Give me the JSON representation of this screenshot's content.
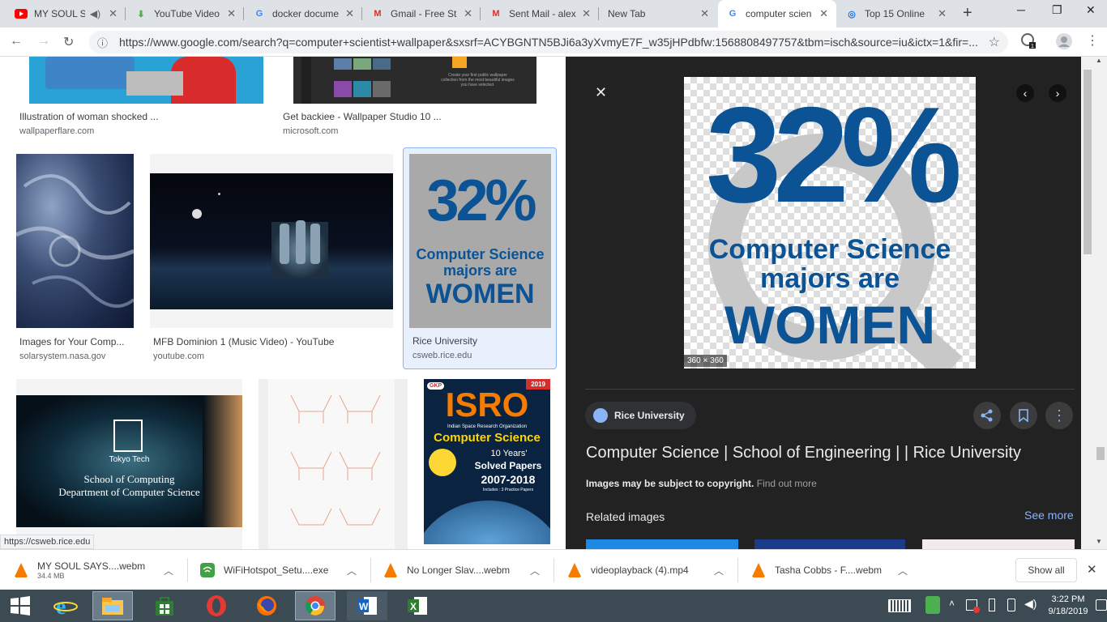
{
  "tabs": [
    {
      "title": "MY SOUL S",
      "icon": "youtube-icon"
    },
    {
      "title": "YouTube Video",
      "icon": "download-icon"
    },
    {
      "title": "docker docume",
      "icon": "google-icon"
    },
    {
      "title": "Gmail - Free St",
      "icon": "gmail-icon"
    },
    {
      "title": "Sent Mail - alex",
      "icon": "gmail-icon"
    },
    {
      "title": "New Tab",
      "icon": ""
    },
    {
      "title": "computer scien",
      "icon": "google-icon"
    },
    {
      "title": "Top 15 Online",
      "icon": "web-icon"
    }
  ],
  "address": {
    "url": "https://www.google.com/search?q=computer+scientist+wallpaper&sxsrf=ACYBGNTN5BJi6a3yXvmyE7F_w35jHPdbfw:1568808497757&tbm=isch&source=iu&ictx=1&fir=..."
  },
  "results": [
    {
      "title": "Illustration of woman shocked ...",
      "source": "wallpaperflare.com"
    },
    {
      "title": "Get backiee - Wallpaper Studio 10 ...",
      "source": "microsoft.com",
      "thumb_text": "Create your first public wallpaper collection from the most beautiful images you have selected."
    },
    {
      "title": "Images for Your Comp...",
      "source": "solarsystem.nasa.gov"
    },
    {
      "title": "MFB Dominion 1 (Music Video) - YouTube",
      "source": "youtube.com"
    },
    {
      "title": "Rice University",
      "source": "csweb.rice.edu"
    },
    {
      "thumb_line1": "Tokyo Tech",
      "thumb_line2": "School of Computing",
      "thumb_line3": "Department of Computer Science"
    },
    {},
    {
      "badge": "GKP",
      "year": "2019",
      "brand": "ISRO",
      "sub": "Indian Space Research Organization",
      "subject": "Computer Science",
      "years": "10 Years'",
      "papers1": "Solved Papers",
      "range": "2007-2018",
      "includes": "Includes : 3 Practice Papers"
    }
  ],
  "poster": {
    "percent": "32%",
    "line1": "Computer Science",
    "line2": "majors are",
    "line3": "WOMEN"
  },
  "preview": {
    "dimensions": "360 × 360",
    "source_chip": "Rice University",
    "title": "Computer Science | School of Engineering | | Rice University",
    "copyright": "Images may be subject to copyright.",
    "find_out_more": "Find out more",
    "related": "Related images",
    "see_more": "See more"
  },
  "status_url": "https://csweb.rice.edu",
  "downloads": [
    {
      "name": "MY SOUL SAYS....webm",
      "size": "34.4 MB"
    },
    {
      "name": "WiFiHotspot_Setu....exe"
    },
    {
      "name": "No Longer Slav....webm"
    },
    {
      "name": "videoplayback (4).mp4"
    },
    {
      "name": "Tasha Cobbs - F....webm"
    }
  ],
  "show_all": "Show all",
  "clock": {
    "time": "3:22 PM",
    "date": "9/18/2019"
  },
  "colors": {
    "accent_blue": "#1a73e8",
    "poster_blue": "#0b5394",
    "dark_panel": "#222222"
  }
}
